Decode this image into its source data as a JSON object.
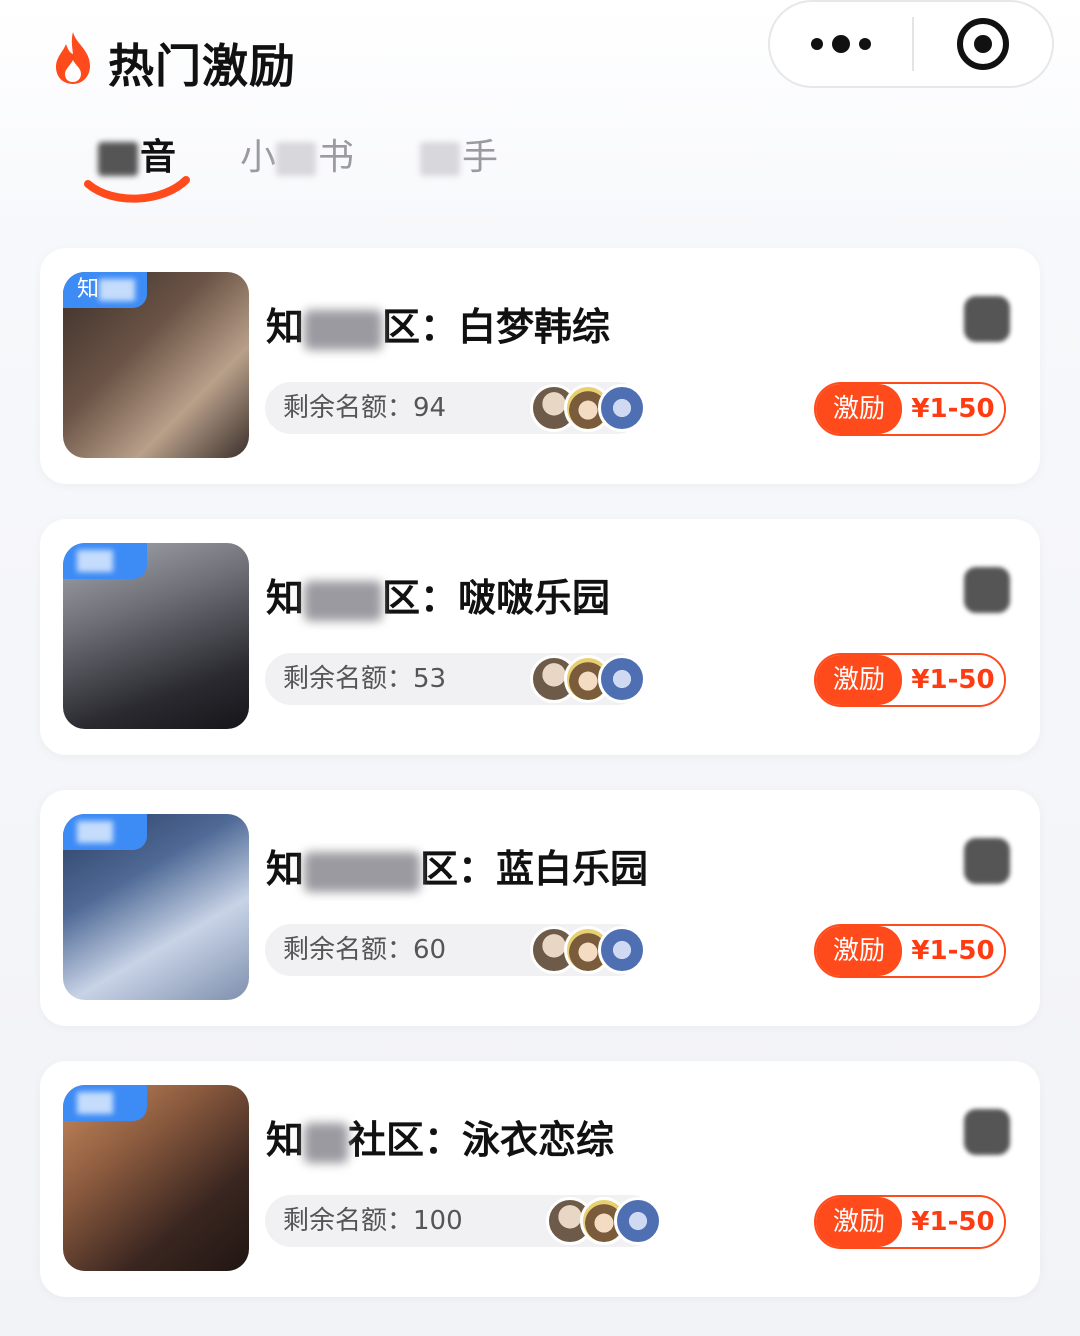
{
  "header": {
    "title": "热门激励",
    "flame_icon": "flame-icon",
    "more_icon": "more-dots-icon",
    "target_icon": "target-icon"
  },
  "tabs": [
    {
      "label_visible": "音",
      "active": true
    },
    {
      "label_visible_start": "小",
      "label_visible_end": "书",
      "active": false
    },
    {
      "label_visible": "手",
      "active": false
    }
  ],
  "colors": {
    "accent": "#ff4a1c",
    "tag_blue": "#3d8bf5"
  },
  "cards": [
    {
      "title_prefix": "知",
      "title_suffix": "区：白梦韩综",
      "quota_label": "剩余名额：",
      "quota_value": "94",
      "reward_label": "激励",
      "reward_amount": "¥1-50",
      "thumb_theme": [
        "#3b2f2a",
        "#b8a08a"
      ]
    },
    {
      "title_prefix": "知",
      "title_suffix": "区：啵啵乐园",
      "quota_label": "剩余名额：",
      "quota_value": "53",
      "reward_label": "激励",
      "reward_amount": "¥1-50",
      "thumb_theme": [
        "#2a2a30",
        "#a7a9b1"
      ]
    },
    {
      "title_prefix": "知",
      "title_suffix": "区：蓝白乐园",
      "quota_label": "剩余名额：",
      "quota_value": "60",
      "reward_label": "激励",
      "reward_amount": "¥1-50",
      "thumb_theme": [
        "#2c3e63",
        "#c8d3e6"
      ]
    },
    {
      "title_prefix": "知",
      "title_suffix": "社区：泳衣恋综",
      "quota_label": "剩余名额：",
      "quota_value": "100",
      "reward_label": "激励",
      "reward_amount": "¥1-50",
      "thumb_theme": [
        "#3a2620",
        "#c98a5d"
      ]
    }
  ]
}
